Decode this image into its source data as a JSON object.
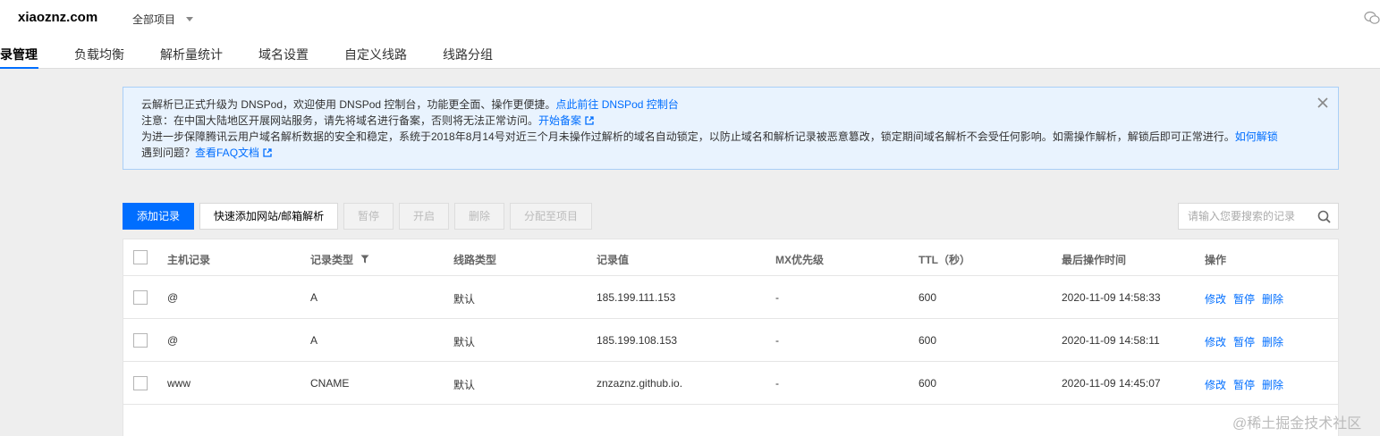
{
  "header": {
    "domain": "xiaoznz.com",
    "project": "全部项目",
    "tabs": [
      {
        "label": "录管理",
        "active": true
      },
      {
        "label": "负载均衡",
        "active": false
      },
      {
        "label": "解析量统计",
        "active": false
      },
      {
        "label": "域名设置",
        "active": false
      },
      {
        "label": "自定义线路",
        "active": false
      },
      {
        "label": "线路分组",
        "active": false
      }
    ]
  },
  "notice": {
    "line1_text": "云解析已正式升级为 DNSPod，欢迎使用 DNSPod 控制台，功能更全面、操作更便捷。",
    "line1_link": "点此前往 DNSPod 控制台",
    "line2_text": "注意：在中国大陆地区开展网站服务，请先将域名进行备案，否则将无法正常访问。",
    "line2_link": "开始备案",
    "line3_text": "为进一步保障腾讯云用户域名解析数据的安全和稳定，系统于2018年8月14号对近三个月未操作过解析的域名自动锁定，以防止域名和解析记录被恶意篡改，锁定期间域名解析不会受任何影响。如需操作解析，解锁后即可正常进行。",
    "line3_link": "如何解锁",
    "line4_text": "遇到问题？",
    "line4_link": "查看FAQ文档"
  },
  "toolbar": {
    "add": "添加记录",
    "quick_add": "快速添加网站/邮箱解析",
    "pause": "暂停",
    "enable": "开启",
    "delete": "删除",
    "assign": "分配至项目"
  },
  "search": {
    "placeholder": "请输入您要搜索的记录"
  },
  "table": {
    "columns": [
      "主机记录",
      "记录类型",
      "线路类型",
      "记录值",
      "MX优先级",
      "TTL（秒）",
      "最后操作时间",
      "操作"
    ],
    "rows": [
      {
        "host": "@",
        "type": "A",
        "line": "默认",
        "value": "185.199.111.153",
        "mx": "-",
        "ttl": "600",
        "time": "2020-11-09 14:58:33"
      },
      {
        "host": "@",
        "type": "A",
        "line": "默认",
        "value": "185.199.108.153",
        "mx": "-",
        "ttl": "600",
        "time": "2020-11-09 14:58:11"
      },
      {
        "host": "www",
        "type": "CNAME",
        "line": "默认",
        "value": "znzaznz.github.io.",
        "mx": "-",
        "ttl": "600",
        "time": "2020-11-09 14:45:07"
      }
    ],
    "ops": {
      "edit": "修改",
      "pause": "暂停",
      "delete": "删除"
    }
  },
  "watermark": "@稀土掘金技术社区",
  "colors": {
    "accent": "#006eff",
    "notice_bg": "#e9f3fe",
    "notice_border": "#a9cff7"
  }
}
